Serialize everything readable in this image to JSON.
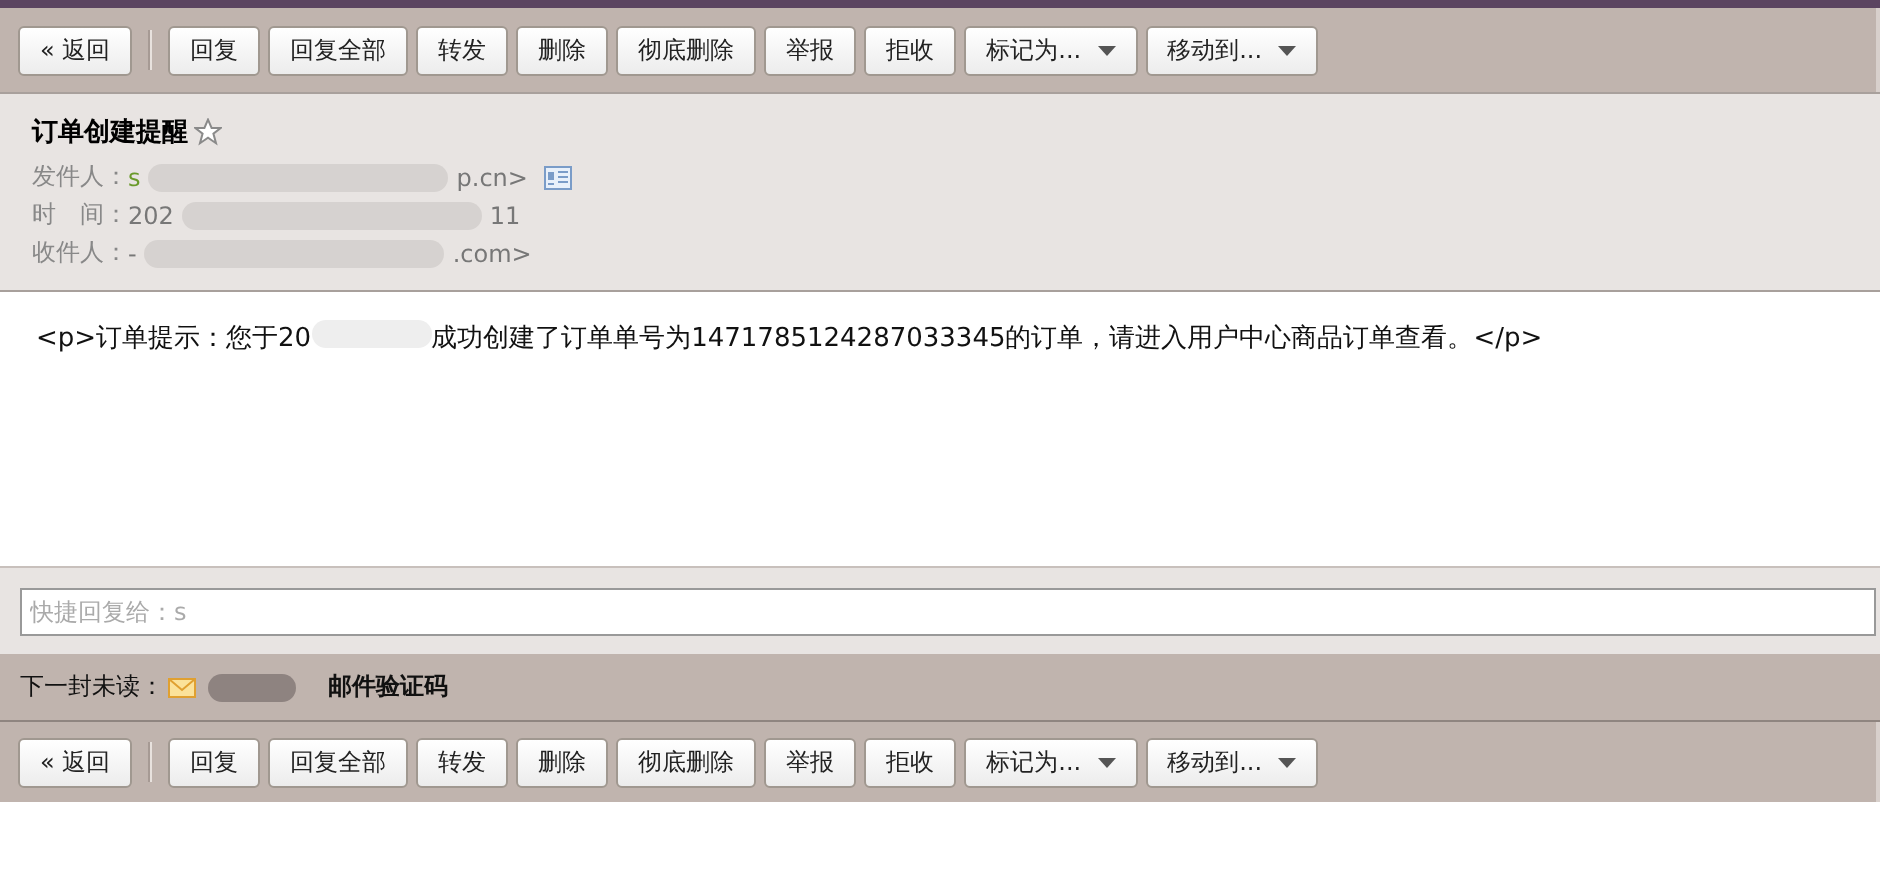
{
  "top_toolbar": [
    {
      "label": "« 返回",
      "kind": "back"
    },
    {
      "label": "回复",
      "kind": "plain"
    },
    {
      "label": "回复全部",
      "kind": "plain"
    },
    {
      "label": "转发",
      "kind": "plain"
    },
    {
      "label": "删除",
      "kind": "plain"
    },
    {
      "label": "彻底删除",
      "kind": "plain"
    },
    {
      "label": "举报",
      "kind": "plain"
    },
    {
      "label": "拒收",
      "kind": "plain"
    },
    {
      "label": "标记为...",
      "kind": "menu"
    },
    {
      "label": "移动到...",
      "kind": "menu"
    }
  ],
  "header": {
    "subject": "订单创建提醒",
    "starred": false,
    "fields": [
      {
        "label": "发件人：",
        "before": "s",
        "after": "p.cn>",
        "card": true
      },
      {
        "label": "时　间：",
        "before": "202",
        "after": "11",
        "card": false
      },
      {
        "label": "收件人：",
        "before": "-",
        "after": ".com>",
        "card": false
      }
    ]
  },
  "body": {
    "before": "<p>订单提示：您于20",
    "after": "成功创建了订单单号为1471785124287033345的订单，请进入用户中心商品订单查看。</p>"
  },
  "quick_reply": {
    "placeholder": "快捷回复给：s"
  },
  "next_unread": {
    "label": "下一封未读：",
    "subject": "邮件验证码"
  },
  "bottom_toolbar": [
    {
      "label": "« 返回",
      "kind": "back"
    },
    {
      "label": "回复",
      "kind": "plain"
    },
    {
      "label": "回复全部",
      "kind": "plain"
    },
    {
      "label": "转发",
      "kind": "plain"
    },
    {
      "label": "删除",
      "kind": "plain"
    },
    {
      "label": "彻底删除",
      "kind": "plain"
    },
    {
      "label": "举报",
      "kind": "plain"
    },
    {
      "label": "拒收",
      "kind": "plain"
    },
    {
      "label": "标记为...",
      "kind": "menu"
    },
    {
      "label": "移动到...",
      "kind": "menu"
    }
  ]
}
